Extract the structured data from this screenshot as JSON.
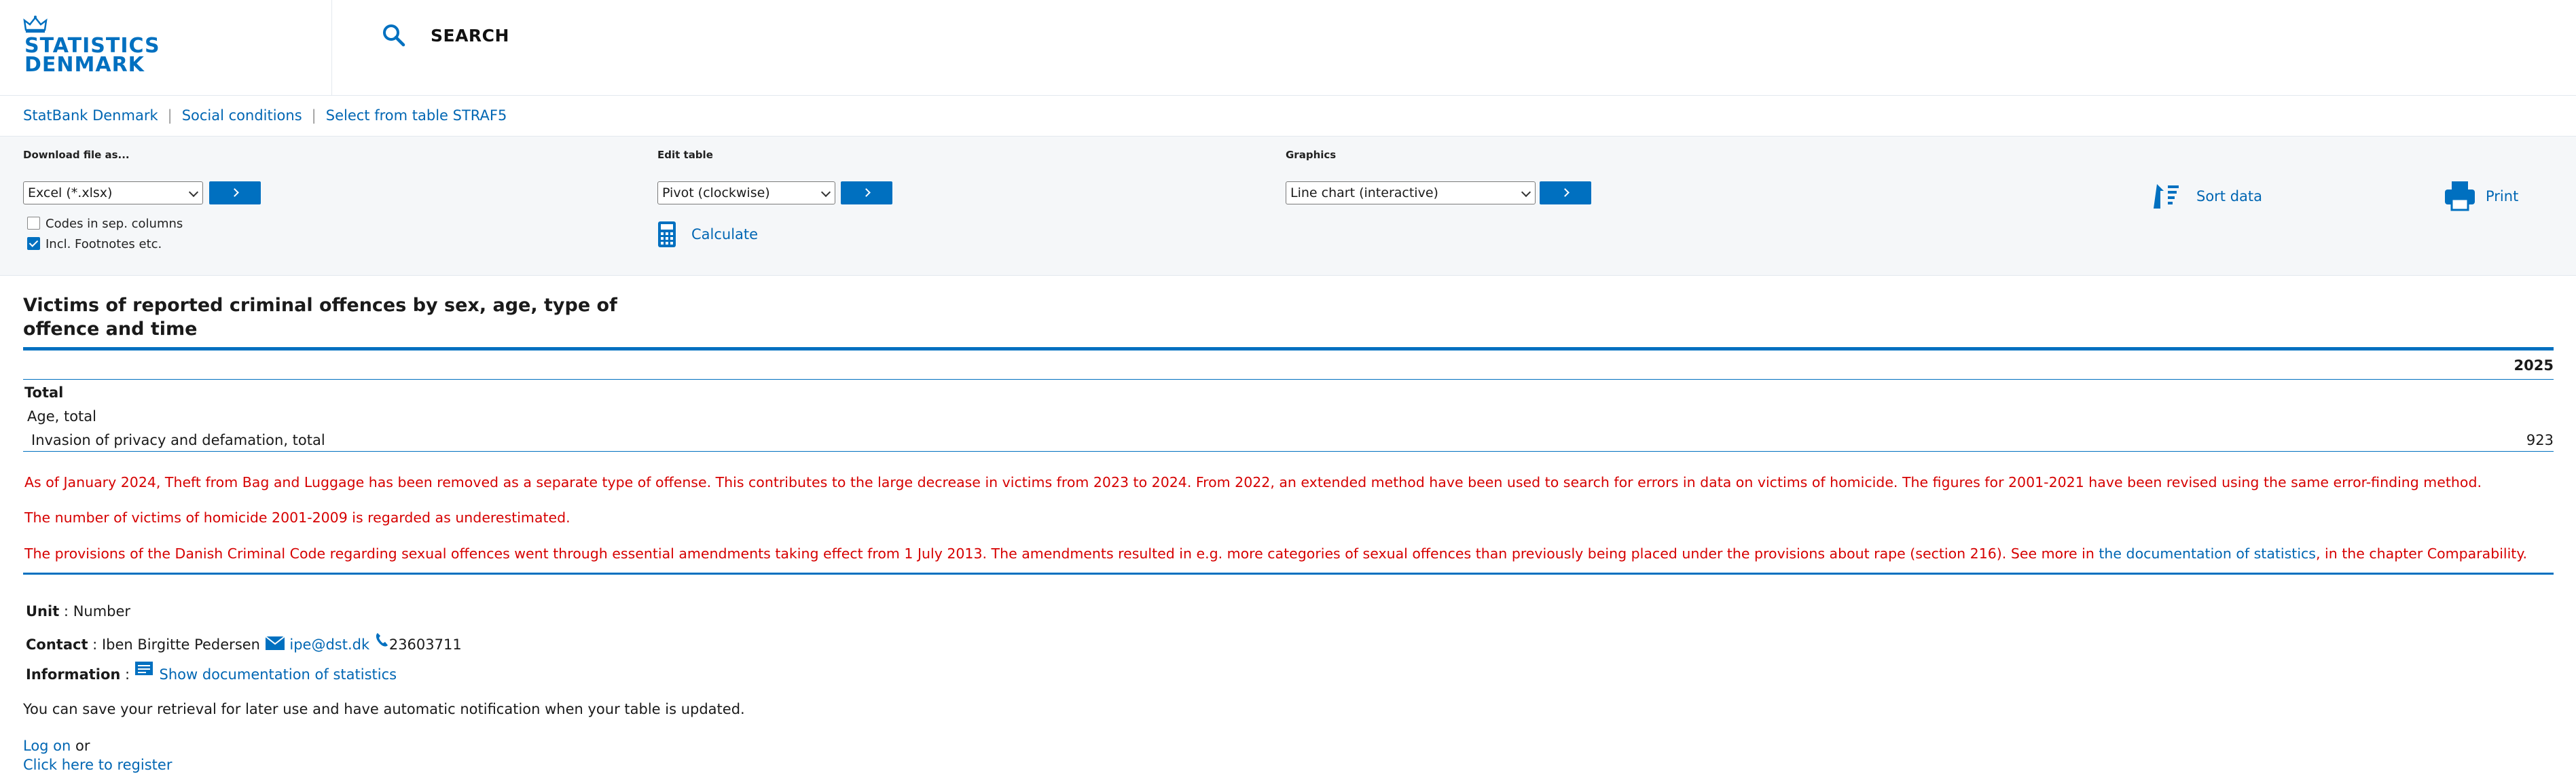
{
  "header": {
    "logo_line1": "STATISTICS",
    "logo_line2": "DENMARK",
    "search_label": "SEARCH"
  },
  "breadcrumb": [
    "StatBank Denmark",
    "Social conditions",
    "Select from table STRAF5"
  ],
  "toolbar": {
    "download_label": "Download file as...",
    "download_value": "Excel (*.xlsx)",
    "codes_label": "Codes in sep. columns",
    "codes_checked": false,
    "footnotes_label": "Incl. Footnotes etc.",
    "footnotes_checked": true,
    "edit_label": "Edit table",
    "edit_value": "Pivot (clockwise)",
    "calculate_label": "Calculate",
    "graphics_label": "Graphics",
    "graphics_value": "Line chart (interactive)",
    "sort_label": "Sort data",
    "print_label": "Print"
  },
  "table": {
    "title": "Victims of reported criminal offences by sex, age, type of offence and time",
    "year": "2025",
    "row1": "Total",
    "row2": "Age, total",
    "row3": "Invasion of privacy and defamation, total",
    "value": "923"
  },
  "notes": {
    "note1": "As of January 2024, Theft from Bag and Luggage has been removed as a separate type of offense. This contributes to the large decrease in victims from 2023 to 2024. From 2022, an extended method have been used to search for errors in data on victims of homicide. The figures for 2001-2021 have been revised using the same error-finding method.",
    "note2": "The number of victims of homicide 2001-2009 is regarded as underestimated.",
    "note3_pre": "The provisions of the Danish Criminal Code regarding sexual offences went through essential amendments taking effect from 1 July 2013. The amendments resulted in e.g. more categories of sexual offences than previously being placed under the provisions about rape (section 216). See more in ",
    "note3_link": "the documentation of statistics",
    "note3_post": ", in the chapter Comparability."
  },
  "footer": {
    "unit_label": "Unit",
    "unit_value": "Number",
    "contact_label": "Contact",
    "contact_name": "Iben Birgitte Pedersen",
    "contact_email": "ipe@dst.dk",
    "contact_phone": "23603711",
    "info_label": "Information",
    "info_link": "Show documentation of statistics",
    "save_text": "You can save your retrieval for later use and have automatic notification when your table is updated.",
    "logon": "Log on",
    "or": "or",
    "register": "Click here to register"
  }
}
